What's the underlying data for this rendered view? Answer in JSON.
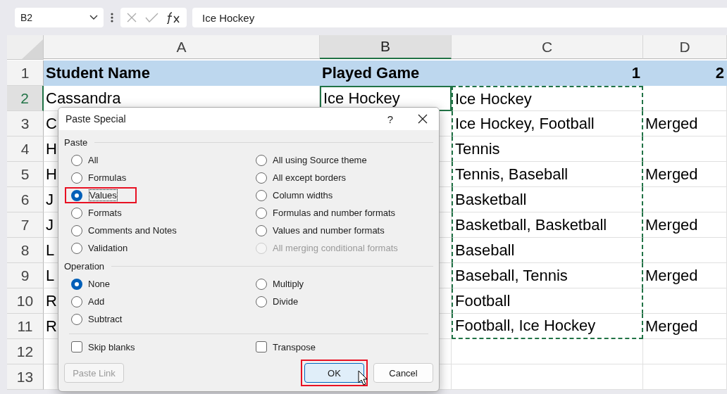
{
  "name_box": {
    "value": "B2"
  },
  "formula_bar": {
    "value": "Ice Hockey"
  },
  "columns": [
    {
      "label": "A",
      "selected": false
    },
    {
      "label": "B",
      "selected": true
    },
    {
      "label": "C",
      "selected": false
    },
    {
      "label": "D",
      "selected": false
    }
  ],
  "rows": [
    {
      "header": "1",
      "selected": false,
      "kind": "header",
      "cells": [
        {
          "text": "Student Name",
          "kind": "text"
        },
        {
          "text": "Played Game",
          "kind": "text"
        },
        {
          "text": "1",
          "kind": "number"
        },
        {
          "text": "2",
          "kind": "number"
        }
      ]
    },
    {
      "header": "2",
      "selected": true,
      "kind": "data",
      "cells": [
        {
          "text": "Cassandra"
        },
        {
          "text": "Ice Hockey",
          "selected": true
        },
        {
          "text": "Ice Hockey",
          "copied": true
        },
        null
      ]
    },
    {
      "header": "3",
      "selected": false,
      "kind": "data",
      "cells": [
        {
          "text": "C"
        },
        null,
        {
          "text": "Ice Hockey, Football",
          "copied": true
        },
        {
          "text": "Merged"
        }
      ]
    },
    {
      "header": "4",
      "selected": false,
      "kind": "data",
      "cells": [
        {
          "text": "H"
        },
        null,
        {
          "text": "Tennis",
          "copied": true
        },
        null
      ]
    },
    {
      "header": "5",
      "selected": false,
      "kind": "data",
      "cells": [
        {
          "text": "H"
        },
        null,
        {
          "text": "Tennis, Baseball",
          "copied": true
        },
        {
          "text": "Merged"
        }
      ]
    },
    {
      "header": "6",
      "selected": false,
      "kind": "data",
      "cells": [
        {
          "text": "J"
        },
        null,
        {
          "text": "Basketball",
          "copied": true
        },
        null
      ]
    },
    {
      "header": "7",
      "selected": false,
      "kind": "data",
      "cells": [
        {
          "text": "J"
        },
        null,
        {
          "text": "Basketball, Basketball",
          "copied": true
        },
        {
          "text": "Merged"
        }
      ]
    },
    {
      "header": "8",
      "selected": false,
      "kind": "data",
      "cells": [
        {
          "text": "L"
        },
        null,
        {
          "text": "Baseball",
          "copied": true
        },
        null
      ]
    },
    {
      "header": "9",
      "selected": false,
      "kind": "data",
      "cells": [
        {
          "text": "L"
        },
        null,
        {
          "text": "Baseball, Tennis",
          "copied": true
        },
        {
          "text": "Merged"
        }
      ]
    },
    {
      "header": "10",
      "selected": false,
      "kind": "data",
      "cells": [
        {
          "text": "R"
        },
        null,
        {
          "text": "Football",
          "copied": true
        },
        null
      ]
    },
    {
      "header": "11",
      "selected": false,
      "kind": "data",
      "cells": [
        {
          "text": "R"
        },
        null,
        {
          "text": "Football, Ice Hockey",
          "copied": true
        },
        {
          "text": "Merged"
        }
      ]
    },
    {
      "header": "12",
      "selected": false,
      "kind": "data",
      "cells": [
        null,
        null,
        null,
        null
      ]
    },
    {
      "header": "13",
      "selected": false,
      "kind": "data",
      "cells": [
        null,
        null,
        null,
        null
      ]
    }
  ],
  "dialog": {
    "title": "Paste Special",
    "help": "?",
    "paste": {
      "label": "Paste",
      "options": [
        {
          "label": "All",
          "selected": false,
          "disabled": false
        },
        {
          "label": "Formulas",
          "selected": false,
          "disabled": false
        },
        {
          "label": "Values",
          "selected": true,
          "disabled": false,
          "highlighted": true
        },
        {
          "label": "Formats",
          "selected": false,
          "disabled": false
        },
        {
          "label": "Comments and Notes",
          "selected": false,
          "disabled": false
        },
        {
          "label": "Validation",
          "selected": false,
          "disabled": false
        },
        {
          "label": "All using Source theme",
          "selected": false,
          "disabled": false
        },
        {
          "label": "All except borders",
          "selected": false,
          "disabled": false
        },
        {
          "label": "Column widths",
          "selected": false,
          "disabled": false
        },
        {
          "label": "Formulas and number formats",
          "selected": false,
          "disabled": false
        },
        {
          "label": "Values and number formats",
          "selected": false,
          "disabled": false
        },
        {
          "label": "All merging conditional formats",
          "selected": false,
          "disabled": true
        }
      ]
    },
    "operation": {
      "label": "Operation",
      "options": [
        {
          "label": "None",
          "selected": true
        },
        {
          "label": "Add",
          "selected": false
        },
        {
          "label": "Subtract",
          "selected": false
        },
        {
          "label": "Multiply",
          "selected": false
        },
        {
          "label": "Divide",
          "selected": false
        }
      ]
    },
    "checkboxes": [
      {
        "label": "Skip blanks",
        "checked": false
      },
      {
        "label": "Transpose",
        "checked": false
      }
    ],
    "buttons": [
      {
        "label": "Paste Link",
        "kind": "secondary",
        "disabled": true
      },
      {
        "label": "OK",
        "kind": "primary",
        "disabled": false,
        "highlighted": true
      },
      {
        "label": "Cancel",
        "kind": "secondary",
        "disabled": false
      }
    ]
  }
}
